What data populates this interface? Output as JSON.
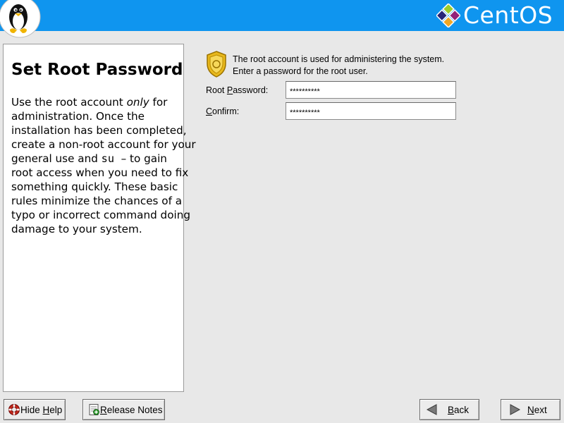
{
  "header": {
    "brand_name": "CentOS",
    "background_color": "#0f95ef",
    "logo_icon": "tux-penguin-icon",
    "brand_icon": "centos-logo-icon"
  },
  "help": {
    "title": "Set Root Password",
    "lines": [
      [
        "Use the root account ",
        "only",
        " for"
      ],
      "administration. Once the",
      "installation has been completed,",
      "create a non-root account for your",
      [
        "general use and ",
        "su",
        "  – to gain"
      ],
      "root access when you need to fix",
      "something quickly. These basic",
      "rules minimize the chances of a",
      "typo or incorrect command doing",
      "damage to your system."
    ]
  },
  "main": {
    "intro_icon": "security-badge-icon",
    "intro_line1": "The root account is used for administering the system.",
    "intro_line2": "Enter a password for the root user.",
    "root_password": {
      "label_pre": "Root ",
      "label_mnemonic": "P",
      "label_post": "assword:",
      "value": "**********"
    },
    "confirm": {
      "label_pre": "",
      "label_mnemonic": "C",
      "label_post": "onfirm:",
      "value": "**********"
    }
  },
  "buttons": {
    "hide_help": {
      "pre": "Hide ",
      "mnemonic": "H",
      "post": "elp",
      "icon": "lifebuoy-icon"
    },
    "release_notes": {
      "mnemonic": "R",
      "post": "elease Notes",
      "icon": "release-notes-icon"
    },
    "back": {
      "mnemonic": "B",
      "post": "ack",
      "icon": "back-arrow-icon"
    },
    "next": {
      "mnemonic": "N",
      "post": "ext",
      "icon": "next-arrow-icon"
    }
  }
}
